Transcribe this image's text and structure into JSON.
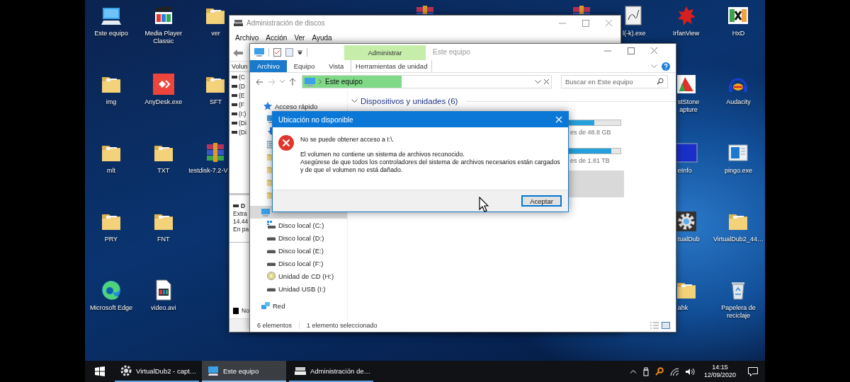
{
  "desktop_icons": [
    {
      "label": "Este equipo",
      "kind": "computer"
    },
    {
      "label": "Media Player Classic",
      "kind": "player"
    },
    {
      "label": "ver",
      "kind": "folder"
    },
    {
      "label": "l(-k).exe",
      "kind": "paint"
    },
    {
      "label": "IrfanView",
      "kind": "viewer"
    },
    {
      "label": "HxD",
      "kind": "hex"
    },
    {
      "label": "img",
      "kind": "folder"
    },
    {
      "label": "AnyDesk.exe",
      "kind": "remote"
    },
    {
      "label": "SFT",
      "kind": "folder"
    },
    {
      "label": "stStone\napture",
      "kind": "capture"
    },
    {
      "label": "Audacity",
      "kind": "audio"
    },
    {
      "label": "mlt",
      "kind": "folder"
    },
    {
      "label": "TXT",
      "kind": "folder"
    },
    {
      "label": "testdisk-7.2-V",
      "kind": "archive"
    },
    {
      "label": "eInfo",
      "kind": "tile"
    },
    {
      "label": "pingo.exe",
      "kind": "app"
    },
    {
      "label": "PRY",
      "kind": "folder"
    },
    {
      "label": "FNT",
      "kind": "folder"
    },
    {
      "label": "tualDub",
      "kind": "gear"
    },
    {
      "label": "VirtualDub2_44…",
      "kind": "folder"
    },
    {
      "label": "Microsoft Edge",
      "kind": "browser"
    },
    {
      "label": "video.avi",
      "kind": "video"
    },
    {
      "label": "ahk",
      "kind": "folder"
    },
    {
      "label": "Papelera de reciclaje",
      "kind": "recycle"
    }
  ],
  "disk_management": {
    "title": "Administración de discos",
    "menu": [
      "Archivo",
      "Acción",
      "Ver",
      "Ayuda"
    ],
    "column_header": "Volun",
    "volumes": [
      "(C",
      "(D",
      "(E",
      "(F",
      "(I:)",
      "(Di",
      "(Di"
    ],
    "disk_label": "D",
    "disk_lines": [
      "Extra",
      "14.44",
      "En pa"
    ],
    "legend": "No"
  },
  "explorer": {
    "context_tab": "Administrar",
    "title": "Este equipo",
    "ribbon_tabs": [
      {
        "label": "Archivo",
        "kind": "standard",
        "selected": true
      },
      {
        "label": "Equipo",
        "kind": "standard",
        "selected": false
      },
      {
        "label": "Vista",
        "kind": "standard",
        "selected": false
      },
      {
        "label": "Herramientas de unidad",
        "kind": "context",
        "selected": false
      }
    ],
    "address": "Este equipo",
    "search": {
      "placeholder": "Buscar en Este equipo"
    },
    "nav": [
      {
        "label": "Acceso rápido",
        "kind": "quick",
        "selected": false
      },
      {
        "kind": "computer",
        "selected": true,
        "children": [
          {
            "label": "Disco local (C:)",
            "kind": "system",
            "selected": false
          },
          {
            "label": "Disco local (D:)",
            "kind": "drive",
            "selected": false
          },
          {
            "label": "Disco local (E:)",
            "kind": "drive",
            "selected": false
          },
          {
            "label": "Disco local (F:)",
            "kind": "drive",
            "selected": false
          },
          {
            "label": "Unidad de CD (H:)",
            "kind": "cd",
            "selected": false
          },
          {
            "label": "Unidad USB (I:)",
            "kind": "usb",
            "selected": false
          }
        ]
      },
      {
        "label": "Red",
        "kind": "network",
        "selected": false
      }
    ],
    "section": "Dispositivos y unidades (6)",
    "drives": [
      {
        "caption": "es de 48.8 GB",
        "level": 0.56,
        "selected": false
      },
      {
        "caption": "es de 1.81 TB",
        "level": 0.84,
        "selected": false
      },
      {
        "selected": true
      }
    ],
    "status": [
      "6 elementos",
      "1 elemento seleccionado"
    ]
  },
  "dialog": {
    "title": "Ubicación no disponible",
    "heading": "No se puede obtener acceso a I:\\.",
    "paragraphs": [
      "El volumen no contiene un sistema de archivos reconocido.",
      "Asegúrese de que todos los controladores del sistema de archivos necesarios están cargados y de que el volumen no está dañado."
    ],
    "button": "Aceptar"
  },
  "taskbar": {
    "items": [
      {
        "label": "VirtualDub2 - capt…",
        "kind": "gear",
        "selected": false
      },
      {
        "label": "Este equipo",
        "kind": "computer",
        "selected": true
      },
      {
        "label": "Administración de…",
        "kind": "disk",
        "selected": false
      }
    ],
    "time": "14:15",
    "date": "12/09/2020"
  }
}
